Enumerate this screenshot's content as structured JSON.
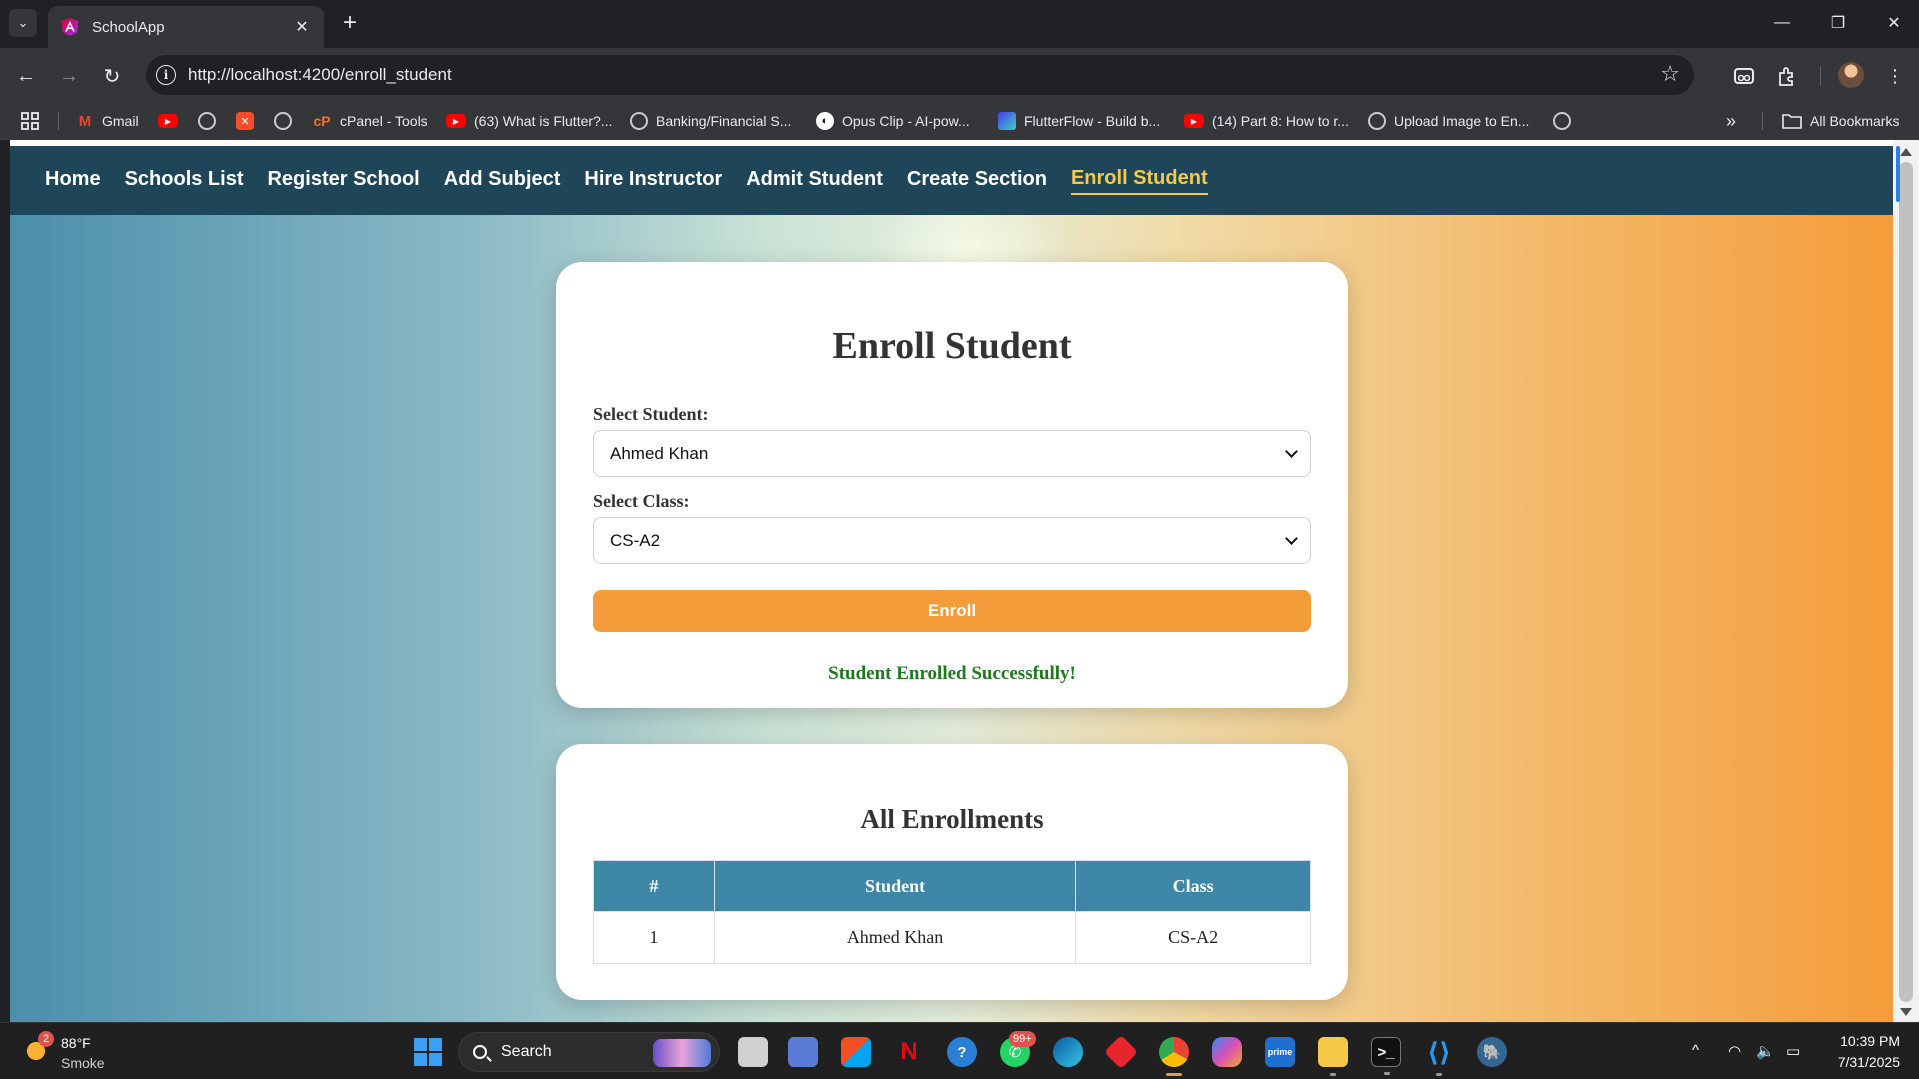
{
  "browser": {
    "tab_title": "SchoolApp",
    "url": "http://localhost:4200/enroll_student",
    "new_tab_glyph": "+",
    "close_glyph": "✕",
    "bookmarks": [
      {
        "label": "Gmail",
        "icon": "gmail-icon"
      },
      {
        "label": "",
        "icon": "youtube-icon"
      },
      {
        "label": "",
        "icon": "globe-icon"
      },
      {
        "label": "",
        "icon": "app-icon"
      },
      {
        "label": "",
        "icon": "globe-icon"
      },
      {
        "label": "cPanel - Tools",
        "icon": "cpanel-icon"
      },
      {
        "label": "(63) What is Flutter?...",
        "icon": "youtube-icon"
      },
      {
        "label": "Banking/Financial S...",
        "icon": "globe-icon"
      },
      {
        "label": "Opus Clip - AI-pow...",
        "icon": "opus-icon"
      },
      {
        "label": "FlutterFlow - Build b...",
        "icon": "flutterflow-icon"
      },
      {
        "label": "(14) Part 8: How to r...",
        "icon": "youtube-icon"
      },
      {
        "label": "Upload Image to En...",
        "icon": "globe-icon"
      },
      {
        "label": "",
        "icon": "globe-icon"
      }
    ],
    "more_bookmarks_glyph": "»",
    "all_bookmarks_label": "All Bookmarks"
  },
  "nav": {
    "items": [
      "Home",
      "Schools List",
      "Register School",
      "Add Subject",
      "Hire Instructor",
      "Admit Student",
      "Create Section",
      "Enroll Student"
    ],
    "active": "Enroll Student",
    "active_color": "#f7c948",
    "bg_color": "#1f4658"
  },
  "form": {
    "title": "Enroll Student",
    "student_label": "Select Student:",
    "student_value": "Ahmed Khan",
    "class_label": "Select Class:",
    "class_value": "CS-A2",
    "submit_label": "Enroll",
    "success_message": "Student Enrolled Successfully!",
    "button_color": "#f59c3a",
    "success_color": "#1b7a1b"
  },
  "enrollments": {
    "title": "All Enrollments",
    "columns": [
      "#",
      "Student",
      "Class"
    ],
    "rows": [
      {
        "n": "1",
        "student": "Ahmed Khan",
        "class": "CS-A2"
      }
    ],
    "header_color": "#3d86a6"
  },
  "taskbar": {
    "weather_badge": "2",
    "temperature": "88°F",
    "condition": "Smoke",
    "search_label": "Search",
    "whatsapp_badge": "99+",
    "time": "10:39 PM",
    "date": "7/31/2025"
  }
}
